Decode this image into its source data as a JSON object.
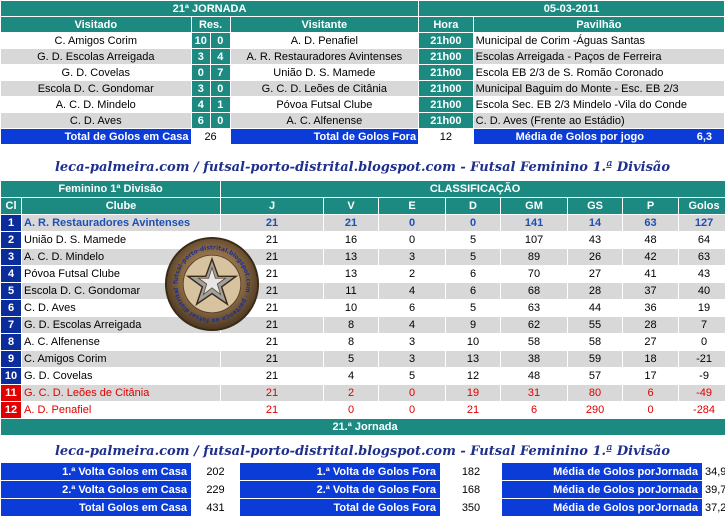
{
  "header": {
    "round": "21ª JORNADA",
    "date": "05-03-2011",
    "col_home": "Visitado",
    "col_result": "Res.",
    "col_away": "Visitante",
    "col_time": "Hora",
    "col_venue": "Pavilhão"
  },
  "matches": [
    {
      "home": "C. Amigos Corim",
      "hs": "10",
      "as": "0",
      "away": "A. D. Penafiel",
      "time": "21h00",
      "venue": "Municipal de Corim -Águas Santas"
    },
    {
      "home": "G. D. Escolas Arreigada",
      "hs": "3",
      "as": "4",
      "away": "A. R. Restauradores Avintenses",
      "time": "21h00",
      "venue": "Escolas Arreigada - Paços de Ferreira"
    },
    {
      "home": "G. D. Covelas",
      "hs": "0",
      "as": "7",
      "away": "União D. S. Mamede",
      "time": "21h00",
      "venue": "Escola EB 2/3 de S. Romão Coronado"
    },
    {
      "home": "Escola D. C. Gondomar",
      "hs": "3",
      "as": "0",
      "away": "G. C. D. Leões de Citânia",
      "time": "21h00",
      "venue": "Municipal Baguim do Monte - Esc. EB 2/3"
    },
    {
      "home": "A. C. D. Mindelo",
      "hs": "4",
      "as": "1",
      "away": "Póvoa Futsal Clube",
      "time": "21h00",
      "venue": "Escola Sec. EB 2/3 Mindelo -Vila do Conde"
    },
    {
      "home": "C. D. Aves",
      "hs": "6",
      "as": "0",
      "away": "A. C. Alfenense",
      "time": "21h00",
      "venue": "C. D. Aves (Frente ao Estádio)"
    }
  ],
  "totals": {
    "home_label": "Total de Golos em Casa",
    "home_value": "26",
    "away_label": "Total de Golos Fora",
    "away_value": "12",
    "avg_label": "Média de Golos por jogo",
    "avg_value": "6,3"
  },
  "banner_text": "leca-palmeira.com / futsal-porto-distrital.blogspot.com - Futsal Feminino 1.ª Divisão",
  "classification": {
    "division": "Feminino 1ª Divisão",
    "title": "CLASSIFICAÇÃO",
    "columns": [
      "Cl",
      "Clube",
      "J",
      "V",
      "E",
      "D",
      "GM",
      "GS",
      "P",
      "Golos"
    ],
    "rows": [
      {
        "pos": "1",
        "club": "A. R. Restauradores Avintenses",
        "j": "21",
        "v": "21",
        "e": "0",
        "d": "0",
        "gm": "141",
        "gs": "14",
        "p": "63",
        "golos": "127"
      },
      {
        "pos": "2",
        "club": "União D. S. Mamede",
        "j": "21",
        "v": "16",
        "e": "0",
        "d": "5",
        "gm": "107",
        "gs": "43",
        "p": "48",
        "golos": "64"
      },
      {
        "pos": "3",
        "club": "A. C. D. Mindelo",
        "j": "21",
        "v": "13",
        "e": "3",
        "d": "5",
        "gm": "89",
        "gs": "26",
        "p": "42",
        "golos": "63"
      },
      {
        "pos": "4",
        "club": "Póvoa Futsal Clube",
        "j": "21",
        "v": "13",
        "e": "2",
        "d": "6",
        "gm": "70",
        "gs": "27",
        "p": "41",
        "golos": "43"
      },
      {
        "pos": "5",
        "club": "Escola D. C. Gondomar",
        "j": "21",
        "v": "11",
        "e": "4",
        "d": "6",
        "gm": "68",
        "gs": "28",
        "p": "37",
        "golos": "40"
      },
      {
        "pos": "6",
        "club": "C. D. Aves",
        "j": "21",
        "v": "10",
        "e": "6",
        "d": "5",
        "gm": "63",
        "gs": "44",
        "p": "36",
        "golos": "19"
      },
      {
        "pos": "7",
        "club": "G. D. Escolas Arreigada",
        "j": "21",
        "v": "8",
        "e": "4",
        "d": "9",
        "gm": "62",
        "gs": "55",
        "p": "28",
        "golos": "7"
      },
      {
        "pos": "8",
        "club": "A. C. Alfenense",
        "j": "21",
        "v": "8",
        "e": "3",
        "d": "10",
        "gm": "58",
        "gs": "58",
        "p": "27",
        "golos": "0"
      },
      {
        "pos": "9",
        "club": "C. Amigos Corim",
        "j": "21",
        "v": "5",
        "e": "3",
        "d": "13",
        "gm": "38",
        "gs": "59",
        "p": "18",
        "golos": "-21"
      },
      {
        "pos": "10",
        "club": "G. D. Covelas",
        "j": "21",
        "v": "4",
        "e": "5",
        "d": "12",
        "gm": "48",
        "gs": "57",
        "p": "17",
        "golos": "-9"
      },
      {
        "pos": "11",
        "club": "G. C. D. Leões de Citânia",
        "j": "21",
        "v": "2",
        "e": "0",
        "d": "19",
        "gm": "31",
        "gs": "80",
        "p": "6",
        "golos": "-49"
      },
      {
        "pos": "12",
        "club": "A. D. Penafiel",
        "j": "21",
        "v": "0",
        "e": "0",
        "d": "21",
        "gm": "6",
        "gs": "290",
        "p": "0",
        "golos": "-284"
      }
    ],
    "footer": "21.ª Jornada"
  },
  "emblem_text": "futsal-porto-distrital.blogspot.com · pertença ao futsal distrital",
  "summary": [
    {
      "l1": "1.ª Volta Golos em Casa",
      "v1": "202",
      "l2": "1.ª Volta de Golos Fora",
      "v2": "182",
      "l3": "Média de Golos porJornada",
      "v3": "34,9"
    },
    {
      "l1": "2.ª Volta Golos em Casa",
      "v1": "229",
      "l2": "2.ª Volta de Golos Fora",
      "v2": "168",
      "l3": "Média de Golos porJornada",
      "v3": "39,7"
    },
    {
      "l1": "Total Golos em Casa",
      "v1": "431",
      "l2": "Total de Golos Fora",
      "v2": "350",
      "l3": "Média de Golos porJornada",
      "v3": "37,2"
    }
  ],
  "colors": {
    "teal": "#1d8a82",
    "navy": "#0a1f7a",
    "blue": "#0b3cd8",
    "red": "#e00000"
  }
}
